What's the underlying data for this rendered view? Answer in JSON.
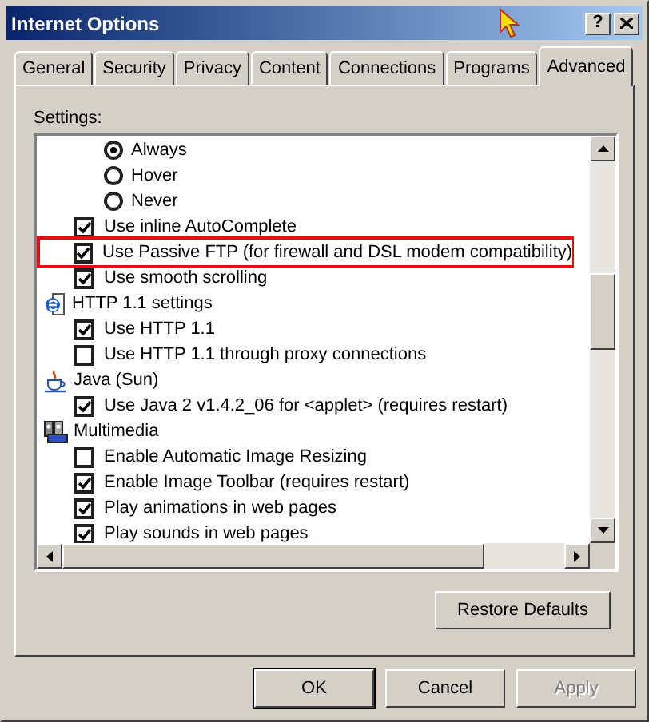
{
  "window": {
    "title": "Internet Options",
    "help": "?"
  },
  "tabs": [
    {
      "label": "General",
      "selected": false
    },
    {
      "label": "Security",
      "selected": false
    },
    {
      "label": "Privacy",
      "selected": false
    },
    {
      "label": "Content",
      "selected": false
    },
    {
      "label": "Connections",
      "selected": false
    },
    {
      "label": "Programs",
      "selected": false
    },
    {
      "label": "Advanced",
      "selected": true
    }
  ],
  "settings": {
    "label": "Settings:",
    "rows": [
      {
        "kind": "radio",
        "label": "Always",
        "checked": true
      },
      {
        "kind": "radio",
        "label": "Hover",
        "checked": false
      },
      {
        "kind": "radio",
        "label": "Never",
        "checked": false
      },
      {
        "kind": "checkbox",
        "label": "Use inline AutoComplete",
        "checked": true,
        "highlighted": false
      },
      {
        "kind": "checkbox",
        "label": "Use Passive FTP (for firewall and DSL modem compatibility)",
        "checked": true,
        "highlighted": true
      },
      {
        "kind": "checkbox",
        "label": "Use smooth scrolling",
        "checked": true,
        "highlighted": false
      },
      {
        "kind": "group",
        "label": "HTTP 1.1 settings"
      },
      {
        "kind": "checkbox",
        "label": "Use HTTP 1.1",
        "checked": true,
        "highlighted": false
      },
      {
        "kind": "checkbox",
        "label": "Use HTTP 1.1 through proxy connections",
        "checked": false,
        "highlighted": false
      },
      {
        "kind": "group",
        "label": "Java (Sun)"
      },
      {
        "kind": "checkbox",
        "label": "Use Java 2 v1.4.2_06 for <applet> (requires restart)",
        "checked": true,
        "highlighted": false
      },
      {
        "kind": "group",
        "label": "Multimedia"
      },
      {
        "kind": "checkbox",
        "label": "Enable Automatic Image Resizing",
        "checked": false,
        "highlighted": false
      },
      {
        "kind": "checkbox",
        "label": "Enable Image Toolbar (requires restart)",
        "checked": true,
        "highlighted": false
      },
      {
        "kind": "checkbox",
        "label": "Play animations in web pages",
        "checked": true,
        "highlighted": false
      },
      {
        "kind": "checkbox",
        "label": "Play sounds in web pages",
        "checked": true,
        "highlighted": false
      }
    ]
  },
  "restore_button": "Restore Defaults",
  "buttons": [
    {
      "label": "OK",
      "default": true,
      "disabled": false
    },
    {
      "label": "Cancel",
      "default": false,
      "disabled": false
    },
    {
      "label": "Apply",
      "default": false,
      "disabled": true
    }
  ]
}
